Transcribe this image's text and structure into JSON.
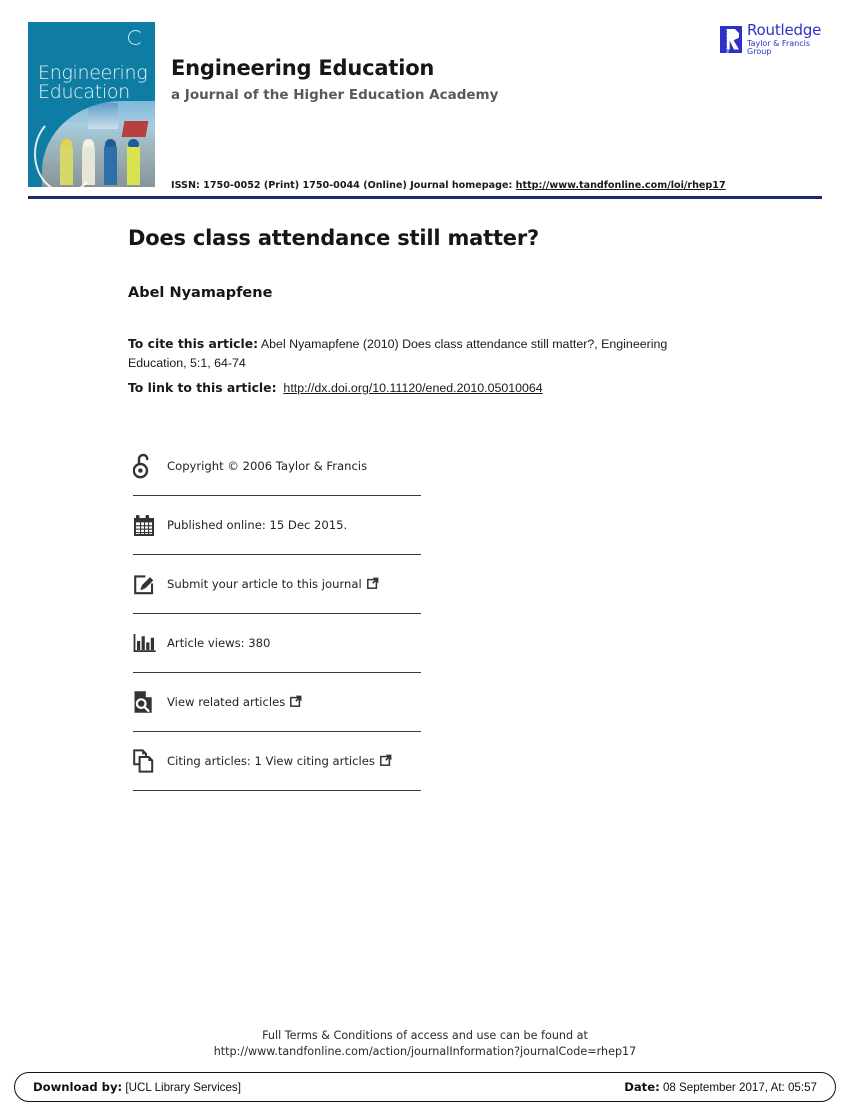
{
  "header": {
    "cover": {
      "line1": "Engineering",
      "line2": "Education",
      "mark_icon": "copyright-c-icon"
    },
    "journal_title": "Engineering Education",
    "journal_subtitle": "a Journal of the Higher Education Academy",
    "issn_text": "ISSN: 1750-0052 (Print) 1750-0044 (Online) Journal homepage: ",
    "issn_link": "http://www.tandfonline.com/loi/rhep17",
    "publisher": {
      "name": "Routledge",
      "tagline": "Taylor & Francis Group",
      "color": "#2c31c8"
    },
    "rule_color": "#1c2b6b"
  },
  "article": {
    "title": "Does class attendance still matter?",
    "author": "Abel Nyamapfene",
    "cite_label": "To cite this article:",
    "cite_text": " Abel Nyamapfene (2010) Does class attendance still matter?, Engineering Education, 5:1, 64-74",
    "link_label": "To link to this article:",
    "link_url": "http://dx.doi.org/10.11120/ened.2010.05010064"
  },
  "meta_rows": [
    {
      "icon": "open-access-lock-icon",
      "label": "Copyright © 2006 Taylor & Francis",
      "external": false
    },
    {
      "icon": "calendar-icon",
      "label": "Published online: 15 Dec 2015.",
      "external": false
    },
    {
      "icon": "submit-pencil-icon",
      "label": "Submit your article to this journal",
      "external": true
    },
    {
      "icon": "bar-chart-icon",
      "label": "Article views: 380",
      "external": false
    },
    {
      "icon": "related-articles-search-icon",
      "label": "View related articles",
      "external": true
    },
    {
      "icon": "citing-articles-copy-icon",
      "label": "Citing articles: 1 View citing articles",
      "external": true
    }
  ],
  "footer": {
    "terms_line1": "Full Terms & Conditions of access and use can be found at",
    "terms_line2": "http://www.tandfonline.com/action/journalInformation?journalCode=rhep17",
    "download_label": "Download by:",
    "download_value": " [UCL Library Services]",
    "date_label": "Date:",
    "date_value": " 08 September 2017, At: 05:57"
  }
}
